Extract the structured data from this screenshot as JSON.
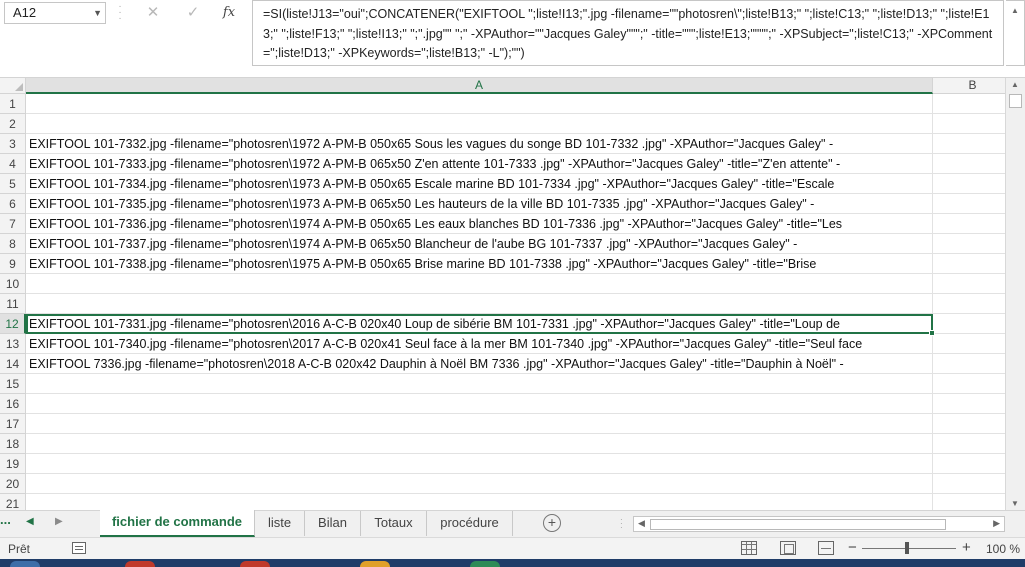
{
  "name_box": {
    "value": "A12"
  },
  "formula_bar": {
    "fx_label": "fx",
    "formula": "=SI(liste!J13=\"oui\";CONCATENER(\"EXIFTOOL \";liste!I13;\".jpg -filename=\"\"photosren\\\";liste!B13;\" \";liste!C13;\" \";liste!D13;\" \";liste!E13;\" \";liste!F13;\" \";liste!I13;\" \";\".jpg\"\" \";\" -XPAuthor=\"\"Jacques Galey\"\"\";\" -title=\"\"\";liste!E13;\"\"\"\";\" -XPSubject=\";liste!C13;\" -XPComment=\";liste!D13;\" -XPKeywords=\";liste!B13;\" -L\");\"\")"
  },
  "columns": [
    "A",
    "B"
  ],
  "rows": [
    {
      "num": "1",
      "a": ""
    },
    {
      "num": "2",
      "a": ""
    },
    {
      "num": "3",
      "a": "EXIFTOOL 101-7332.jpg -filename=\"photosren\\1972 A-PM-B 050x65 Sous les vagues du songe BD 101-7332 .jpg\"  -XPAuthor=\"Jacques Galey\" -"
    },
    {
      "num": "4",
      "a": "EXIFTOOL 101-7333.jpg -filename=\"photosren\\1972 A-PM-B 065x50 Z'en attente  101-7333 .jpg\"  -XPAuthor=\"Jacques Galey\" -title=\"Z'en attente\" -"
    },
    {
      "num": "5",
      "a": "EXIFTOOL 101-7334.jpg -filename=\"photosren\\1973 A-PM-B 050x65 Escale marine BD 101-7334 .jpg\"  -XPAuthor=\"Jacques Galey\" -title=\"Escale"
    },
    {
      "num": "6",
      "a": "EXIFTOOL 101-7335.jpg -filename=\"photosren\\1973 A-PM-B 065x50 Les hauteurs de la ville BD 101-7335 .jpg\"  -XPAuthor=\"Jacques Galey\" -"
    },
    {
      "num": "7",
      "a": "EXIFTOOL 101-7336.jpg -filename=\"photosren\\1974 A-PM-B 050x65 Les eaux blanches BD 101-7336 .jpg\"  -XPAuthor=\"Jacques Galey\" -title=\"Les"
    },
    {
      "num": "8",
      "a": "EXIFTOOL 101-7337.jpg -filename=\"photosren\\1974 A-PM-B 065x50 Blancheur de l'aube BG 101-7337 .jpg\"  -XPAuthor=\"Jacques Galey\" -"
    },
    {
      "num": "9",
      "a": "EXIFTOOL 101-7338.jpg -filename=\"photosren\\1975 A-PM-B 050x65 Brise marine BD 101-7338 .jpg\"  -XPAuthor=\"Jacques Galey\" -title=\"Brise"
    },
    {
      "num": "10",
      "a": ""
    },
    {
      "num": "11",
      "a": ""
    },
    {
      "num": "12",
      "a": "EXIFTOOL 101-7331.jpg -filename=\"photosren\\2016 A-C-B 020x40 Loup de sibérie BM 101-7331 .jpg\"  -XPAuthor=\"Jacques Galey\" -title=\"Loup de"
    },
    {
      "num": "13",
      "a": "EXIFTOOL 101-7340.jpg -filename=\"photosren\\2017 A-C-B 020x41 Seul face à la mer BM 101-7340 .jpg\"  -XPAuthor=\"Jacques Galey\" -title=\"Seul face"
    },
    {
      "num": "14",
      "a": "EXIFTOOL 7336.jpg -filename=\"photosren\\2018 A-C-B 020x42 Dauphin à Noël BM 7336 .jpg\"  -XPAuthor=\"Jacques Galey\" -title=\"Dauphin à Noël\" -"
    },
    {
      "num": "15",
      "a": ""
    },
    {
      "num": "16",
      "a": ""
    },
    {
      "num": "17",
      "a": ""
    },
    {
      "num": "18",
      "a": ""
    },
    {
      "num": "19",
      "a": ""
    },
    {
      "num": "20",
      "a": ""
    },
    {
      "num": "21",
      "a": ""
    }
  ],
  "active_row": "12",
  "sheet_nav": {
    "more": "..."
  },
  "tabs": [
    {
      "label": "fichier de commande",
      "active": true
    },
    {
      "label": "liste",
      "active": false
    },
    {
      "label": "Bilan",
      "active": false
    },
    {
      "label": "Totaux",
      "active": false
    },
    {
      "label": "procédure",
      "active": false
    }
  ],
  "status": {
    "text": "Prêt",
    "zoom": "100 %"
  },
  "icons": {
    "name_box_dropdown": "chevron-down-icon",
    "cancel": "close-icon",
    "enter": "checkmark-icon",
    "function": "fx-icon",
    "add_sheet": "plus-circle-icon",
    "macro": "macro-record-icon"
  },
  "colors": {
    "accent": "#217346",
    "taskbar": "#1f3c68"
  }
}
